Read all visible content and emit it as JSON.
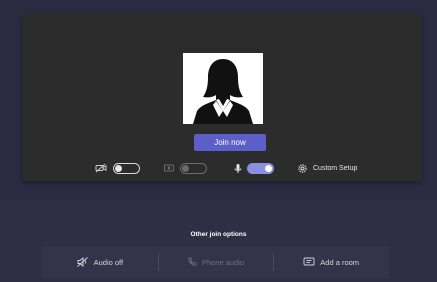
{
  "preview": {
    "avatar_icon": "person-silhouette-icon",
    "join_label": "Join now"
  },
  "controls": {
    "camera": {
      "icon": "video-off-icon",
      "state": "off"
    },
    "blur": {
      "icon": "background-blur-icon",
      "state": "disabled"
    },
    "mic": {
      "icon": "microphone-icon",
      "state": "on"
    },
    "setup": {
      "icon": "gear-icon",
      "label": "Custom Setup"
    }
  },
  "other_options": {
    "title": "Other join options",
    "items": [
      {
        "icon": "speaker-off-icon",
        "label": "Audio off",
        "enabled": true
      },
      {
        "icon": "phone-icon",
        "label": "Phone audio",
        "enabled": false
      },
      {
        "icon": "cast-room-icon",
        "label": "Add a room",
        "enabled": true
      }
    ]
  },
  "colors": {
    "accent": "#5b5fc7",
    "toggle_on": "#8c8fe0",
    "panel": "#2d2c2c",
    "background": "#2f2e46"
  }
}
